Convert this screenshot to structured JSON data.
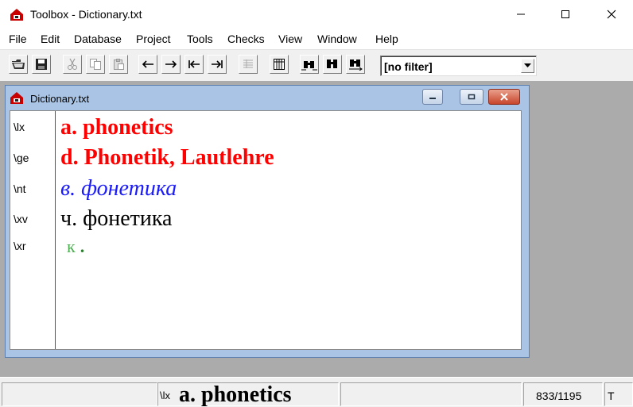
{
  "window": {
    "title": "Toolbox - Dictionary.txt"
  },
  "menu": [
    "File",
    "Edit",
    "Database",
    "Project",
    "Tools",
    "Checks",
    "View",
    "Window",
    "Help"
  ],
  "toolbar": {
    "filter_value": "[no filter]",
    "icons": [
      "open-folder-icon",
      "save-icon",
      "cut-icon",
      "copy-icon",
      "paste-icon",
      "arrow-left-icon",
      "arrow-right-icon",
      "arrow-first-icon",
      "arrow-last-icon",
      "list-view-icon",
      "browse-view-icon",
      "find-icon",
      "find-next-icon",
      "find-replace-icon"
    ]
  },
  "child_window": {
    "title": "Dictionary.txt"
  },
  "record": {
    "fields": [
      {
        "marker": "\\lx",
        "value": "a. phonetics",
        "color": "#ff0000"
      },
      {
        "marker": "\\ge",
        "value": "d. Phonetik, Lautlehre",
        "color": "#ff0000"
      },
      {
        "marker": "\\nt",
        "value": "в. фонетика",
        "color": "#1a1aff"
      },
      {
        "marker": "\\xv",
        "value": "ч. фонетика",
        "color": "#000000"
      },
      {
        "marker": "\\xr",
        "value": "к",
        "suffix": ".",
        "color": "#4caf50"
      }
    ]
  },
  "status": {
    "marker": "\\lx",
    "value": "a. phonetics",
    "position": "833/1195",
    "extra": "T"
  }
}
